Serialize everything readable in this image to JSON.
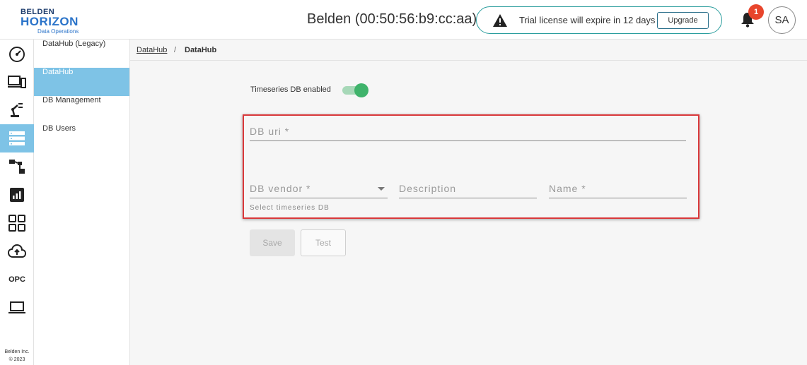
{
  "header": {
    "logo_line1": "BELDEN",
    "logo_line2": "HORIZON",
    "logo_line3": "Data Operations",
    "device_title": "Belden (00:50:56:b9:cc:aa)",
    "trial_message": "Trial license will expire in 12 days",
    "upgrade_label": "Upgrade",
    "notification_count": "1",
    "avatar_initials": "SA"
  },
  "icon_rail": {
    "items": [
      {
        "icon": "dashboard-gauge-icon"
      },
      {
        "icon": "devices-icon"
      },
      {
        "icon": "robot-arm-icon"
      },
      {
        "icon": "database-icon",
        "active": true
      },
      {
        "icon": "flow-diagram-icon"
      },
      {
        "icon": "analytics-chart-icon"
      },
      {
        "icon": "apps-grid-icon"
      },
      {
        "icon": "cloud-upload-icon"
      },
      {
        "icon": "opc-text-icon",
        "label": "OPC"
      },
      {
        "icon": "laptop-icon"
      }
    ],
    "copyright_line1": "Belden Inc.",
    "copyright_line2": "© 2023"
  },
  "subnav": {
    "items": [
      {
        "label": "DataHub (Legacy)"
      },
      {
        "label": "DataHub",
        "active": true
      },
      {
        "label": "DB Management"
      },
      {
        "label": "DB Users"
      }
    ]
  },
  "breadcrumb": {
    "link": "DataHub",
    "separator": "/",
    "current": "DataHub"
  },
  "form": {
    "toggle_label": "Timeseries DB enabled",
    "toggle_on": true,
    "db_uri_placeholder": "DB uri *",
    "db_vendor_placeholder": "DB vendor *",
    "db_vendor_hint": "Select timeseries DB",
    "description_placeholder": "Description",
    "name_placeholder": "Name *",
    "save_label": "Save",
    "test_label": "Test"
  },
  "colors": {
    "accent_active": "#7ec3e6",
    "toggle_on": "#3fb36b",
    "highlight_border": "#d9383a",
    "trial_border": "#2a9d9d",
    "badge": "#e8452c"
  }
}
